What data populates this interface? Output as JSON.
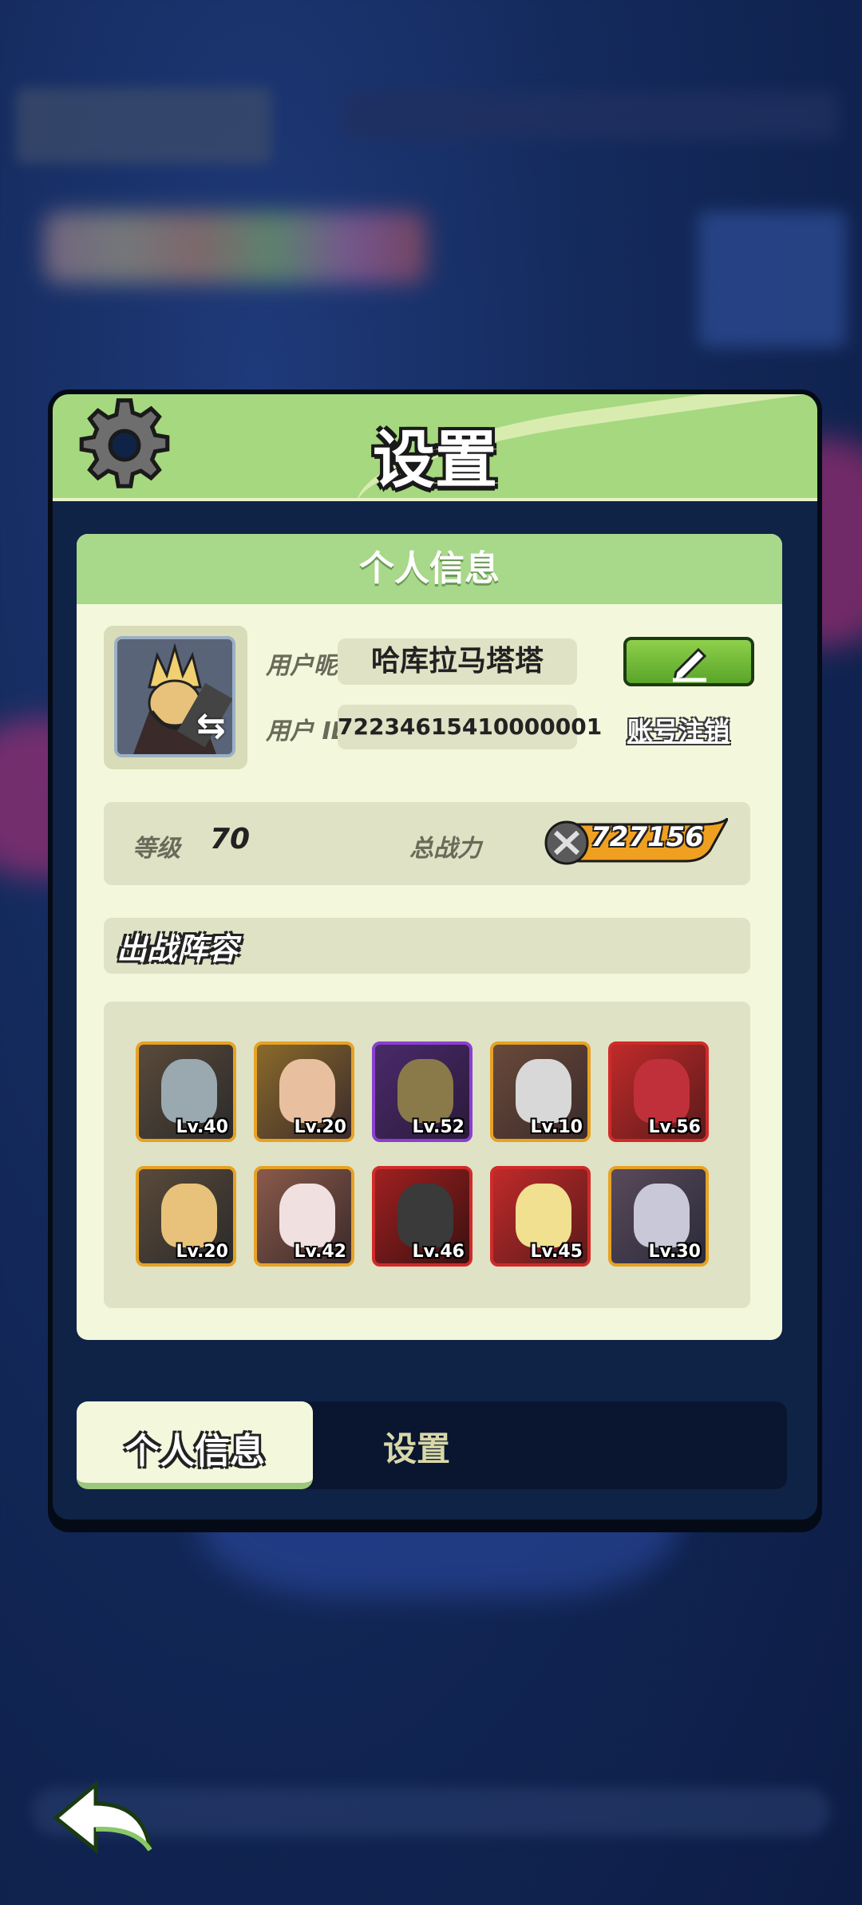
{
  "modal": {
    "title": "设置",
    "section_title": "个人信息",
    "nickname_label": "用户昵称",
    "nickname_value": "哈库拉马塔塔",
    "id_label": "用户 ID",
    "id_value": "72234615410000001",
    "delete_account_label": "账号注销",
    "level_label": "等级",
    "level_value": "70",
    "power_label": "总战力",
    "power_value": "727156",
    "lineup_title": "出战阵容",
    "heroes": [
      {
        "level": "Lv.40",
        "rarity": "gold"
      },
      {
        "level": "Lv.20",
        "rarity": "gold"
      },
      {
        "level": "Lv.52",
        "rarity": "purple"
      },
      {
        "level": "Lv.10",
        "rarity": "gold"
      },
      {
        "level": "Lv.56",
        "rarity": "red"
      },
      {
        "level": "Lv.20",
        "rarity": "gold"
      },
      {
        "level": "Lv.42",
        "rarity": "gold"
      },
      {
        "level": "Lv.46",
        "rarity": "red"
      },
      {
        "level": "Lv.45",
        "rarity": "red"
      },
      {
        "level": "Lv.30",
        "rarity": "gold"
      }
    ]
  },
  "tabs": [
    {
      "label": "个人信息",
      "active": true
    },
    {
      "label": "设置",
      "active": false
    }
  ],
  "colors": {
    "header_green": "#a6d87f",
    "panel_cream": "#f3f8dc",
    "edit_green": "#5aa52a",
    "gold_frame": "#e7a224",
    "purple_frame": "#8a3fd0",
    "red_frame": "#d02a2a"
  }
}
